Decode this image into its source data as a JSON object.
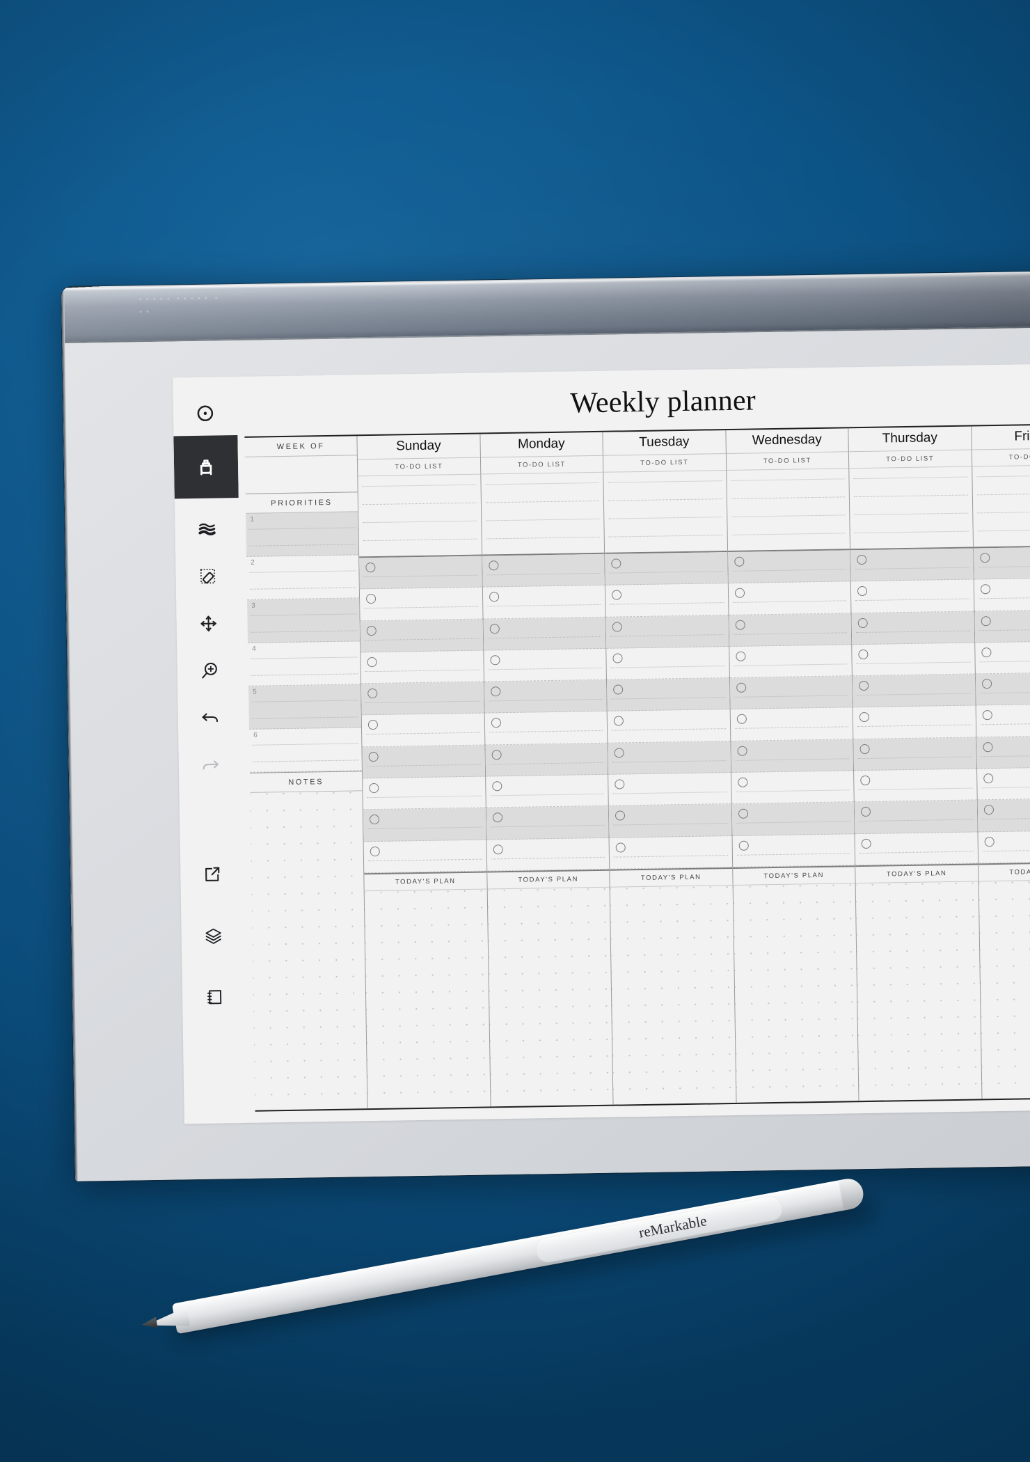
{
  "scene": {
    "background_color": "#0a5080",
    "device_name": "reMarkable tablet",
    "stylus_brand": "reMarkable"
  },
  "toolbar": {
    "items": [
      {
        "name": "menu-toggle-icon",
        "label": "Menu",
        "active": false,
        "dim": false
      },
      {
        "name": "pen-tool-icon",
        "label": "Pen",
        "active": true,
        "dim": false
      },
      {
        "name": "brush-strokes-icon",
        "label": "Strokes",
        "active": false,
        "dim": false
      },
      {
        "name": "eraser-tool-icon",
        "label": "Eraser",
        "active": false,
        "dim": false
      },
      {
        "name": "move-selection-icon",
        "label": "Move",
        "active": false,
        "dim": false
      },
      {
        "name": "zoom-in-icon",
        "label": "Zoom",
        "active": false,
        "dim": false
      },
      {
        "name": "undo-icon",
        "label": "Undo",
        "active": false,
        "dim": false
      },
      {
        "name": "redo-icon",
        "label": "Redo",
        "active": false,
        "dim": true
      },
      {
        "name": "share-export-icon",
        "label": "Share",
        "active": false,
        "dim": false
      },
      {
        "name": "layers-icon",
        "label": "Layers",
        "active": false,
        "dim": false
      },
      {
        "name": "pages-icon",
        "label": "Pages",
        "active": false,
        "dim": false
      }
    ]
  },
  "planner": {
    "title": "Weekly planner",
    "left_column": {
      "week_of_label": "WEEK OF",
      "week_of_value": "",
      "priorities_label": "PRIORITIES",
      "priorities": [
        {
          "number": "1",
          "value": ""
        },
        {
          "number": "2",
          "value": ""
        },
        {
          "number": "3",
          "value": ""
        },
        {
          "number": "4",
          "value": ""
        },
        {
          "number": "5",
          "value": ""
        },
        {
          "number": "6",
          "value": ""
        }
      ],
      "notes_label": "NOTES",
      "notes_value": ""
    },
    "day_columns": [
      {
        "name": "Sunday",
        "todo_label": "TO-DO LIST",
        "plan_label": "TODAY'S PLAN"
      },
      {
        "name": "Monday",
        "todo_label": "TO-DO LIST",
        "plan_label": "TODAY'S PLAN"
      },
      {
        "name": "Tuesday",
        "todo_label": "TO-DO LIST",
        "plan_label": "TODAY'S PLAN"
      },
      {
        "name": "Wednesday",
        "todo_label": "TO-DO LIST",
        "plan_label": "TODAY'S PLAN"
      },
      {
        "name": "Thursday",
        "todo_label": "TO-DO LIST",
        "plan_label": "TODAY'S PLAN"
      },
      {
        "name": "Friday",
        "todo_label": "TO-DO LIST",
        "plan_label": "TODAY'S PLAN"
      }
    ],
    "schedule_rows": 10,
    "todo_lines": 4
  }
}
